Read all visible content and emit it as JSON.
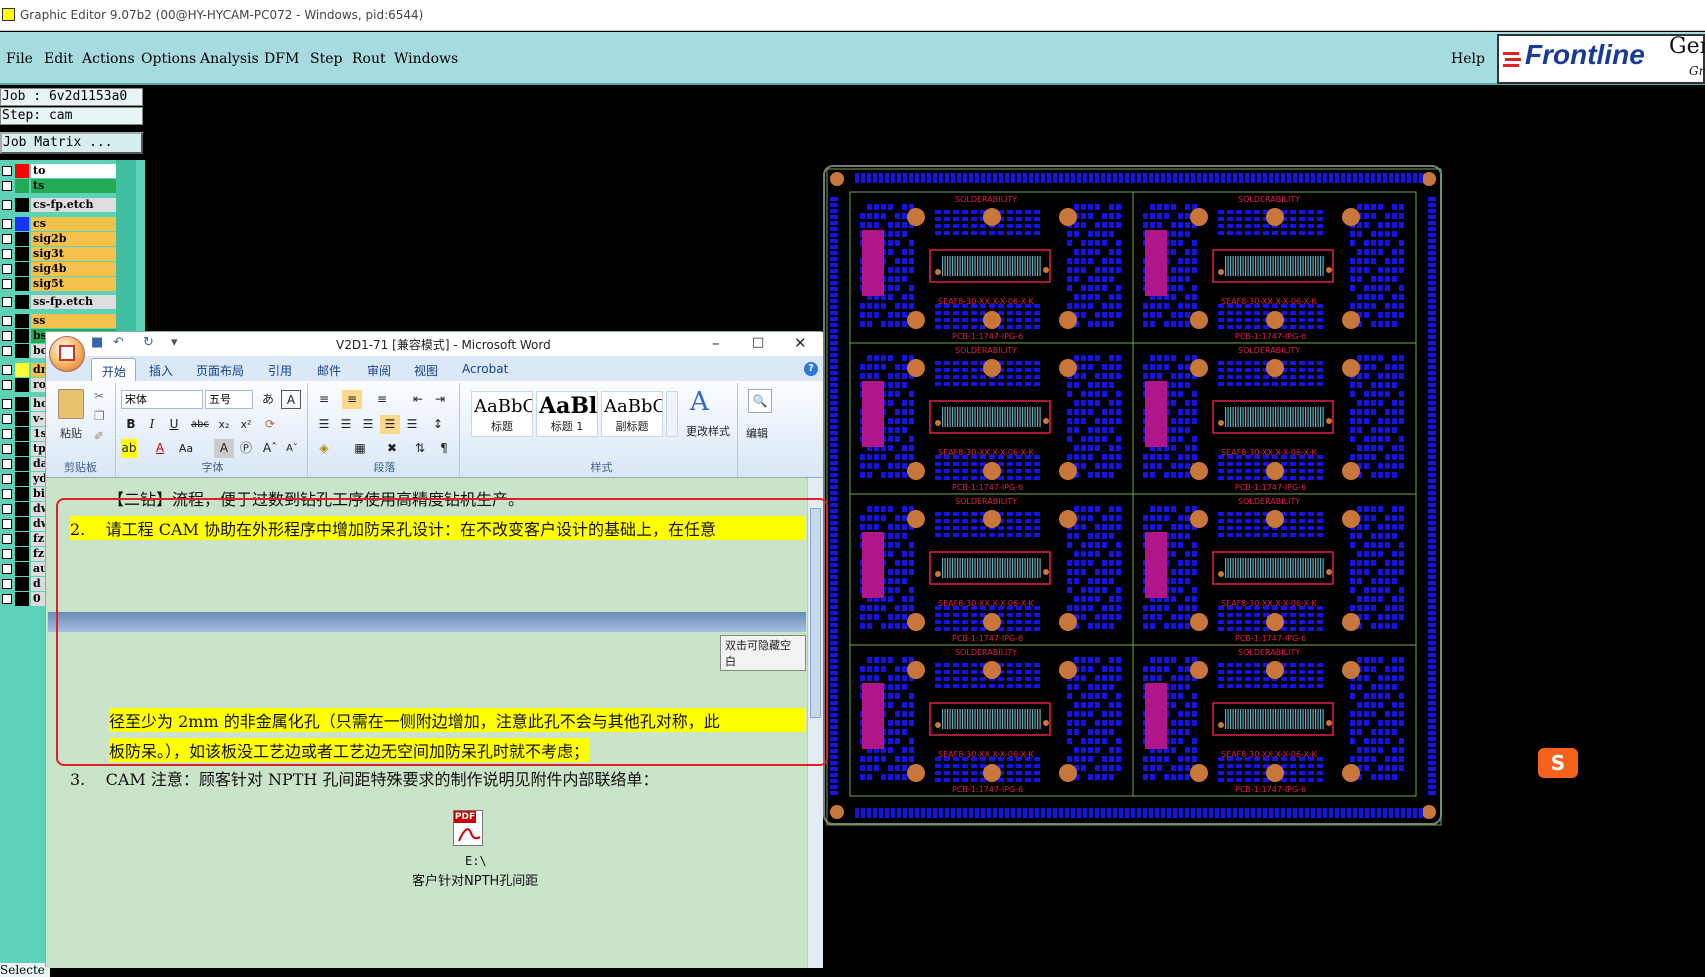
{
  "window": {
    "title": "Graphic Editor 9.07b2 (00@HY-HYCAM-PC072 - Windows, pid:6544)"
  },
  "menu": {
    "items": [
      "File",
      "Edit",
      "Actions",
      "Options",
      "Analysis",
      "DFM",
      "Step",
      "Rout",
      "Windows"
    ],
    "help": "Help"
  },
  "logo": {
    "brand": "Frontline",
    "sub": "Ger",
    "sub2": "Gr"
  },
  "job": {
    "job_line": "Job : 6v2d1153a0",
    "step_line": "Step: cam",
    "matrix_button": "Job Matrix ..."
  },
  "layers": [
    {
      "name": "to",
      "color": "#ffffff",
      "swatch": "#ff0000"
    },
    {
      "name": "ts",
      "color": "#22aa55",
      "swatch": "#22aa55"
    },
    {
      "name": "cs-fp.etch",
      "color": "#dddddd",
      "swatch": ""
    },
    {
      "name": "cs",
      "color": "#f5c14d",
      "swatch": "#1a33ff"
    },
    {
      "name": "sig2b",
      "color": "#f5c14d",
      "swatch": ""
    },
    {
      "name": "sig3t",
      "color": "#f5c14d",
      "swatch": ""
    },
    {
      "name": "sig4b",
      "color": "#f5c14d",
      "swatch": ""
    },
    {
      "name": "sig5t",
      "color": "#f5c14d",
      "swatch": ""
    },
    {
      "name": "ss-fp.etch",
      "color": "#dddddd",
      "swatch": ""
    },
    {
      "name": "ss",
      "color": "#f5c14d",
      "swatch": ""
    },
    {
      "name": "bs",
      "color": "#22aa55",
      "swatch": ""
    },
    {
      "name": "bo",
      "color": "#dddddd",
      "swatch": ""
    },
    {
      "name": "dr",
      "color": "#f5c14d",
      "swatch": "#ffff33"
    },
    {
      "name": "ro",
      "color": "#dddddd",
      "swatch": ""
    },
    {
      "name": "ho",
      "color": "#dddddd",
      "swatch": ""
    },
    {
      "name": "v-",
      "color": "#dddddd",
      "swatch": ""
    },
    {
      "name": "1s",
      "color": "#dddddd",
      "swatch": ""
    },
    {
      "name": "tp",
      "color": "#dddddd",
      "swatch": ""
    },
    {
      "name": "da",
      "color": "#dddddd",
      "swatch": ""
    },
    {
      "name": "yd",
      "color": "#dddddd",
      "swatch": ""
    },
    {
      "name": "bi",
      "color": "#dddddd",
      "swatch": ""
    },
    {
      "name": "dw",
      "color": "#dddddd",
      "swatch": ""
    },
    {
      "name": "dw",
      "color": "#dddddd",
      "swatch": ""
    },
    {
      "name": "fz",
      "color": "#dddddd",
      "swatch": ""
    },
    {
      "name": "fz",
      "color": "#dddddd",
      "swatch": ""
    },
    {
      "name": "au",
      "color": "#dddddd",
      "swatch": ""
    },
    {
      "name": "d",
      "color": "#dddddd",
      "swatch": ""
    },
    {
      "name": "0",
      "color": "#dddddd",
      "swatch": ""
    }
  ],
  "status": {
    "selected": "Selecte"
  },
  "word": {
    "title": "V2D1-71 [兼容模式] - Microsoft Word",
    "tabs": [
      "开始",
      "插入",
      "页面布局",
      "引用",
      "邮件",
      "审阅",
      "视图",
      "Acrobat"
    ],
    "clipboard": {
      "paste": "粘贴",
      "label": "剪贴板"
    },
    "font": {
      "name": "宋体",
      "size": "五号",
      "label": "字体"
    },
    "paragraph": {
      "label": "段落"
    },
    "styles": {
      "items": [
        {
          "sample": "AaBbC",
          "name": "标题"
        },
        {
          "sample": "AaBl",
          "name": "标题 1"
        },
        {
          "sample": "AaBbC",
          "name": "副标题"
        }
      ],
      "change": "更改样式",
      "label": "样式"
    },
    "editing": {
      "label": "编辑"
    },
    "doc": {
      "line0": "【二钻】流程，便于过数到钻孔工序使用高精度钻机生产。",
      "line1_num": "2.",
      "line1": "请工程 CAM 协助在外形程序中增加防呆孔设计：在不改变客户设计的基础上，在任意",
      "hide_hint": "双击可隐藏空白",
      "line2": "径至少为 2mm 的非金属化孔（只需在一侧附边增加，注意此孔不会与其他孔对称，此",
      "line3": "板防呆。），如该板没工艺边或者工艺边无空间加防呆孔时就不考虑；",
      "line4_num": "3.",
      "line4": "CAM 注意：顾客针对 NPTH 孔间距特殊要求的制作说明见附件内部联络单：",
      "attachment_tag": "PDF",
      "attachment_path": "E:\\",
      "attachment_name": "客户针对NPTH孔间距"
    }
  },
  "pcb": {
    "label_top": "SOLDERABILITY",
    "label_mid": "SEAF8-30-XX.X-X-06-X-K",
    "label_bot": "PCB-1:1747-IPG-6",
    "colors": {
      "copper": "#1414e6",
      "outline": "#6fa84a",
      "pad": "#c8763a",
      "text": "#e0204a"
    }
  },
  "ime": {
    "label": "S"
  }
}
